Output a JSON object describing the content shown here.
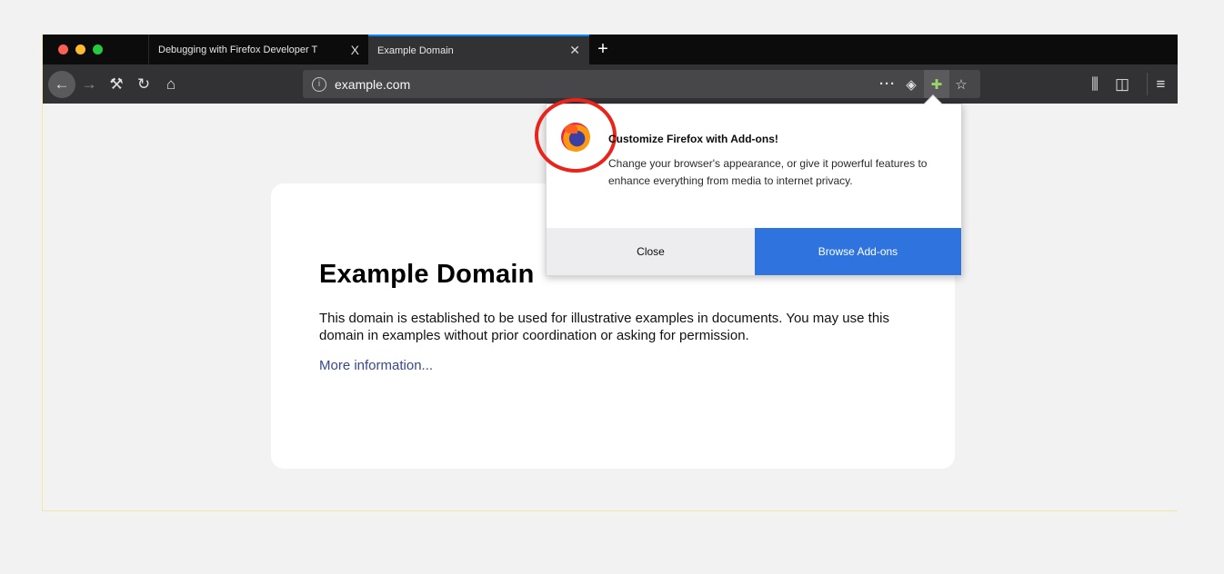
{
  "tabs": [
    {
      "label": "Debugging with Firefox Developer T",
      "close": "X"
    },
    {
      "label": "Example Domain",
      "close": "✕"
    }
  ],
  "new_tab": "+",
  "url": "example.com",
  "page": {
    "heading": "Example Domain",
    "paragraph": "This domain is established to be used for illustrative examples in documents. You may use this domain in examples without prior coordination or asking for permission.",
    "link": "More information..."
  },
  "popup": {
    "title": "Customize Firefox with Add-ons!",
    "body": "Change your browser's appearance, or give it powerful features to enhance everything from media to internet privacy.",
    "close_label": "Close",
    "browse_label": "Browse Add-ons"
  },
  "icons": {
    "back": "←",
    "forward": "→",
    "tools": "⚒",
    "reload": "↻",
    "home": "⌂",
    "more": "···",
    "pocket": "◈",
    "addon": "✚",
    "star": "☆",
    "library": "⫼",
    "sidebar": "◫",
    "menu": "≡",
    "info": "i"
  },
  "colors": {
    "accent": "#2f74de",
    "highlight_ring": "#e8241c",
    "link": "#38488f"
  }
}
